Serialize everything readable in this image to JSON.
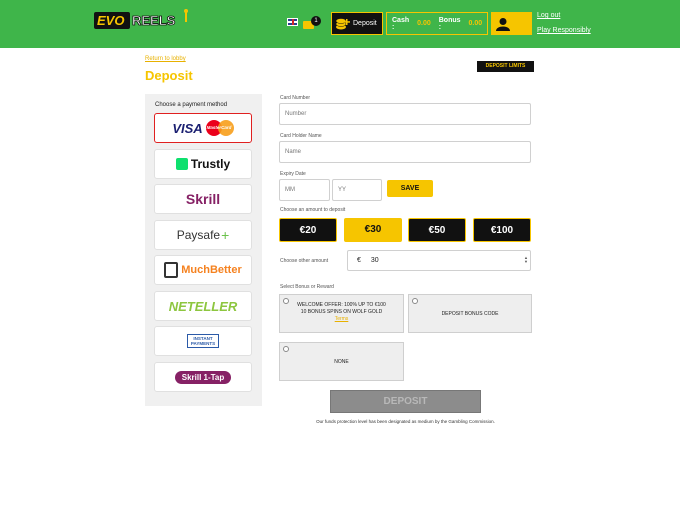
{
  "header": {
    "logo": {
      "left": "EVO",
      "right": "REELS"
    },
    "mail_count": "1",
    "deposit_label": "Deposit",
    "cash_label": "Cash :",
    "cash_value": "0.00",
    "bonus_label": "Bonus :",
    "bonus_value": "0.00",
    "logout": "Log out",
    "play_responsibly": "Play Responsibly"
  },
  "page": {
    "return_link": "Return to lobby",
    "title": "Deposit",
    "deposit_limits": "DEPOSIT LIMITS"
  },
  "methods": {
    "title": "Choose a payment method",
    "items": [
      {
        "name": "VISA",
        "extra": "MasterCard",
        "selected": true
      },
      {
        "name": "Trustly"
      },
      {
        "name": "Skrill"
      },
      {
        "name": "Paysafe"
      },
      {
        "name": "MuchBetter"
      },
      {
        "name": "NETELLER"
      },
      {
        "name": "INSTANT PAYMENTS"
      },
      {
        "name": "Skrill 1-Tap"
      }
    ]
  },
  "form": {
    "card_number_label": "Card Number",
    "card_number_placeholder": "Number",
    "holder_label": "Card Holder Name",
    "holder_placeholder": "Name",
    "expiry_label": "Expiry Date",
    "mm_placeholder": "MM",
    "yy_placeholder": "YY",
    "save": "SAVE",
    "amount_label": "Choose an amount to deposit",
    "amounts": [
      "€20",
      "€30",
      "€50",
      "€100"
    ],
    "selected_amount": "€30",
    "other_label": "Choose other amount",
    "currency": "€",
    "other_value": "30",
    "bonus_label": "Select Bonus or Reward",
    "bonus_welcome_1": "WELCOME OFFER: 100% UP TO €100",
    "bonus_welcome_2": "10 BONUS SPINS ON WOLF GOLD",
    "bonus_terms": "Terms",
    "bonus_code": "DEPOSIT BONUS CODE",
    "bonus_none": "NONE",
    "submit": "DEPOSIT",
    "note": "Our funds protection level has been designated as medium by the Gambling Commission."
  },
  "colors": {
    "header_green": "#3fb54a",
    "accent_yellow": "#f6c500",
    "dark": "#111111"
  }
}
